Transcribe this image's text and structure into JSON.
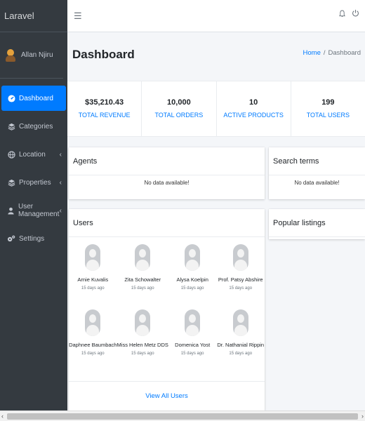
{
  "brand": "Laravel",
  "user": {
    "name": "Allan Njiru"
  },
  "nav": [
    {
      "label": "Dashboard",
      "active": true,
      "icon": "dashboard-icon",
      "chevron": ""
    },
    {
      "label": "Categories",
      "active": false,
      "icon": "layers-icon",
      "chevron": ""
    },
    {
      "label": "Location",
      "active": false,
      "icon": "globe-icon",
      "chevron": "‹"
    },
    {
      "label": "Properties",
      "active": false,
      "icon": "layers-icon",
      "chevron": "‹"
    },
    {
      "label": "User Management",
      "active": false,
      "icon": "user-icon",
      "chevron": "‹"
    },
    {
      "label": "Settings",
      "active": false,
      "icon": "cogs-icon",
      "chevron": ""
    }
  ],
  "header": {
    "title": "Dashboard",
    "breadcrumb": {
      "home": "Home",
      "sep": "/",
      "current": "Dashboard"
    }
  },
  "stats": [
    {
      "value": "$35,210.43",
      "label": "TOTAL REVENUE"
    },
    {
      "value": "10,000",
      "label": "TOTAL ORDERS"
    },
    {
      "value": "10",
      "label": "ACTIVE PRODUCTS"
    },
    {
      "value": "199",
      "label": "TOTAL USERS"
    }
  ],
  "cards": {
    "agents": {
      "title": "Agents",
      "empty": "No data available!"
    },
    "search_terms": {
      "title": "Search terms",
      "empty": "No data available!"
    },
    "users": {
      "title": "Users",
      "view_all": "View All Users"
    },
    "popular": {
      "title": "Popular listings"
    }
  },
  "users": [
    {
      "name": "Arnie Kuvalis",
      "time": "15 days ago"
    },
    {
      "name": "Zita Schowalter",
      "time": "15 days ago"
    },
    {
      "name": "Alysa Koelpin",
      "time": "15 days ago"
    },
    {
      "name": "Prof. Patsy Abshire",
      "time": "15 days ago"
    },
    {
      "name": "Daphnee Baumbach",
      "time": "15 days ago"
    },
    {
      "name": "Miss Helen Metz DDS",
      "time": "15 days ago"
    },
    {
      "name": "Domenica Yost",
      "time": "15 days ago"
    },
    {
      "name": "Dr. Nathanial Rippin",
      "time": "15 days ago"
    }
  ],
  "colors": {
    "sidebar": "#343a40",
    "accent": "#007bff",
    "background": "#f4f6f9"
  }
}
